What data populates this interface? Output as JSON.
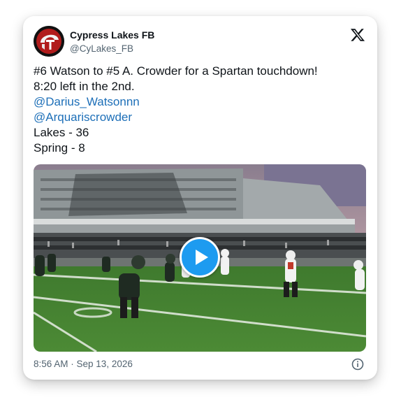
{
  "author": {
    "display_name": "Cypress Lakes FB",
    "handle": "@CyLakes_FB",
    "avatar_icon": "cypress-lakes-spartan-logo"
  },
  "tweet": {
    "lines": [
      "#6 Watson to #5 A. Crowder for a Spartan touchdown!",
      "8:20 left in the 2nd."
    ],
    "mentions": [
      "@Darius_Watsonnn",
      "@Arquariscrowder"
    ],
    "score_lines": [
      "Lakes - 36",
      "Spring - 8"
    ]
  },
  "media": {
    "type": "video",
    "play_icon": "play-icon"
  },
  "footer": {
    "timestamp": "8:56 AM · Sep 13, 2026",
    "info_icon": "info-icon"
  },
  "colors": {
    "link": "#1d6fb8",
    "play_button": "#1d9bf0",
    "text": "#0f1419",
    "muted": "#536471"
  }
}
